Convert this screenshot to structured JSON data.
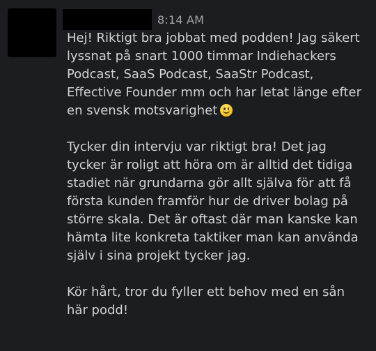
{
  "message": {
    "timestamp": "8:14 AM",
    "paragraphs": [
      "Hej! Riktigt bra jobbat med podden! Jag säkert lyssnat på snart 1000 timmar Indiehackers Podcast, SaaS Podcast, SaaStr Podcast, Effective Founder mm och har letat länge efter en svensk motsvarighet",
      "Tycker din intervju var riktigt bra! Det jag tycker är roligt att höra om är alltid det tidiga stadiet när grundarna gör allt själva för att få första kunden framför hur de driver bolag på större skala. Det är oftast där man kanske kan hämta lite konkreta taktiker man kan använda själv i sina projekt tycker jag.",
      "Kör hårt, tror du fyller ett behov med en sån här podd!"
    ],
    "emoji": "slightly-smiling-face-icon"
  },
  "colors": {
    "background": "#1c1d21",
    "text": "#d1d2d3",
    "timestamp": "#a3a5aa",
    "redaction": "#000000"
  }
}
